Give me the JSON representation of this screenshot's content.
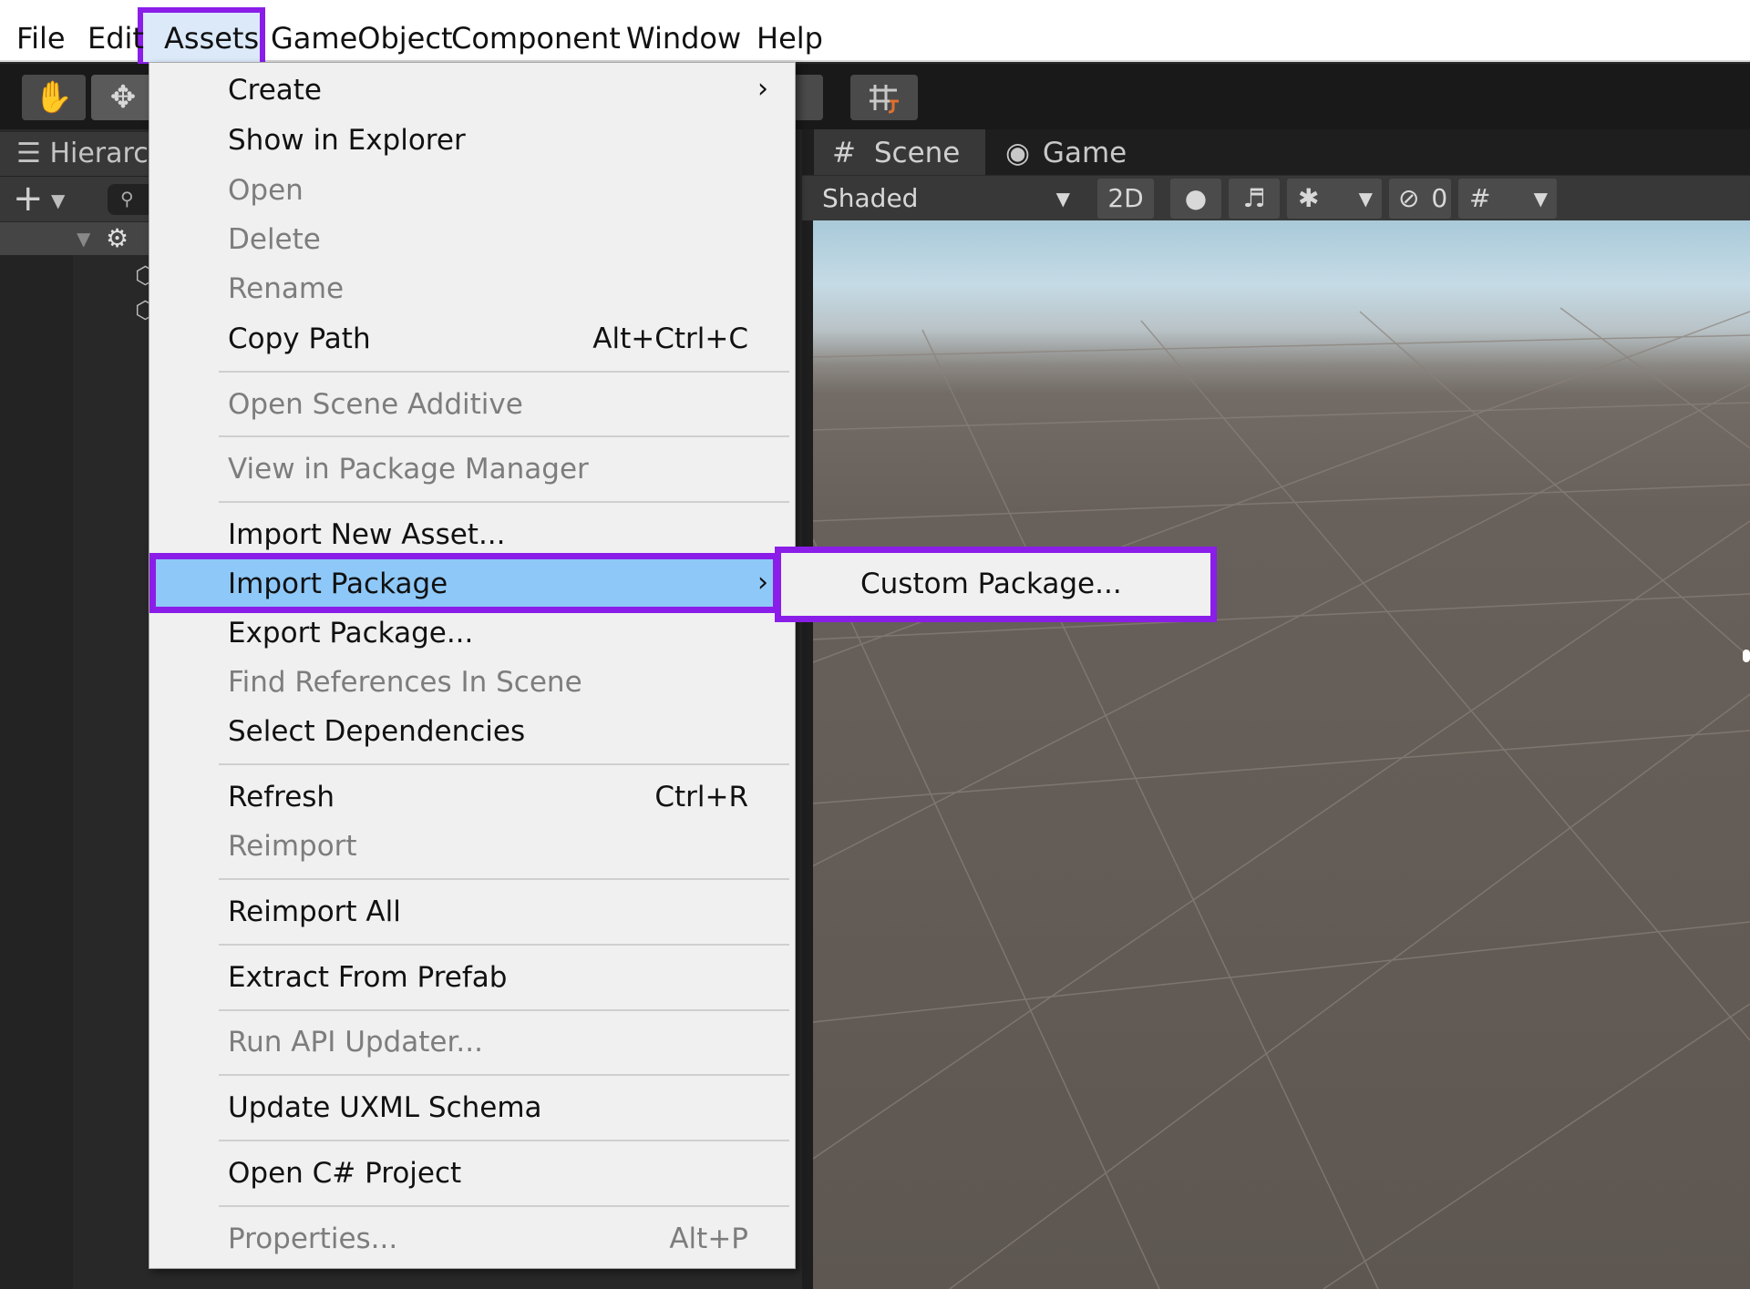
{
  "menubar": {
    "file": "File",
    "edit": "Edit",
    "assets": "Assets",
    "gameobject": "GameObject",
    "component": "Component",
    "window": "Window",
    "help": "Help"
  },
  "hierarchy": {
    "tab_label": "Hierarchy"
  },
  "scene": {
    "tab_scene": "Scene",
    "tab_game": "Game",
    "shading_mode": "Shaded",
    "mode_2d": "2D",
    "hidden_count": "0"
  },
  "assets_menu": {
    "items": [
      {
        "label": "Create",
        "enabled": true,
        "submenu": true
      },
      {
        "label": "Show in Explorer",
        "enabled": true
      },
      {
        "label": "Open",
        "enabled": false
      },
      {
        "label": "Delete",
        "enabled": false
      },
      {
        "label": "Rename",
        "enabled": false
      },
      {
        "label": "Copy Path",
        "enabled": true,
        "shortcut": "Alt+Ctrl+C"
      },
      {
        "label": "Open Scene Additive",
        "enabled": false
      },
      {
        "label": "View in Package Manager",
        "enabled": false
      },
      {
        "label": "Import New Asset...",
        "enabled": true
      },
      {
        "label": "Import Package",
        "enabled": true,
        "submenu": true,
        "highlighted": true
      },
      {
        "label": "Export Package...",
        "enabled": true
      },
      {
        "label": "Find References In Scene",
        "enabled": false
      },
      {
        "label": "Select Dependencies",
        "enabled": true
      },
      {
        "label": "Refresh",
        "enabled": true,
        "shortcut": "Ctrl+R"
      },
      {
        "label": "Reimport",
        "enabled": false
      },
      {
        "label": "Reimport All",
        "enabled": true
      },
      {
        "label": "Extract From Prefab",
        "enabled": true
      },
      {
        "label": "Run API Updater...",
        "enabled": false
      },
      {
        "label": "Update UXML Schema",
        "enabled": true
      },
      {
        "label": "Open C# Project",
        "enabled": true
      },
      {
        "label": "Properties...",
        "enabled": false,
        "shortcut": "Alt+P"
      }
    ]
  },
  "import_package_submenu": {
    "custom_package": "Custom Package..."
  },
  "colors": {
    "highlight_frame": "#8a1ee8",
    "menu_selection": "#8ec8f8",
    "menu_background": "#f0f0f0",
    "editor_dark": "#282828"
  }
}
